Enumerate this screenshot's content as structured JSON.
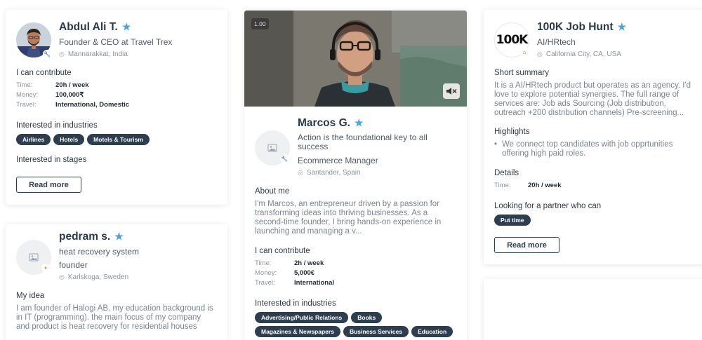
{
  "cards": {
    "abdul": {
      "name": "Abdul Ali T.",
      "role": "Founder & CEO at Travel Trex",
      "location": "Mannarakkat, India",
      "contribute_title": "I can contribute",
      "time_label": "Time:",
      "time_value": "20h / week",
      "money_label": "Money:",
      "money_value": "100,000₹",
      "travel_label": "Travel:",
      "travel_value": "International, Domestic",
      "industries_title": "Interested in industries",
      "industries": [
        "Airlines",
        "Hotels",
        "Motels & Tourism"
      ],
      "stages_title": "Interested in stages",
      "read_more": "Read more"
    },
    "pedram": {
      "name": "pedram s.",
      "tagline": "heat recovery system",
      "role": "founder",
      "location": "Karlskoga, Sweden",
      "idea_title": "My idea",
      "idea_text": "I am founder of Halogi AB. my education background is in IT (programming). the main focus of my company and product is heat recovery for residential houses"
    },
    "marcos": {
      "video_rate": "1.00",
      "name": "Marcos G.",
      "tagline": "Action is the foundational key to all success",
      "role": "Ecommerce Manager",
      "location": "Santander, Spain",
      "about_title": "About me",
      "about_text": "I'm Marcos, an entrepreneur driven by a passion for transforming ideas into thriving businesses. As a second-time founder, I bring hands-on experience in launching and managing a v...",
      "contribute_title": "I can contribute",
      "time_label": "Time:",
      "time_value": "2h / week",
      "money_label": "Money:",
      "money_value": "5,000€",
      "travel_label": "Travel:",
      "travel_value": "International",
      "industries_title": "Interested in industries",
      "industries": [
        "Advertising/Public Relations",
        "Books",
        "Magazines & Newspapers",
        "Business Services",
        "Education"
      ]
    },
    "job": {
      "logo_text": "100K",
      "name": "100K Job Hunt",
      "role": "AI/HRtech",
      "location": "California City, CA, USA",
      "summary_title": "Short summary",
      "summary_text": "It is a AI/HRtech product but operates as an agency. I'd love to explore potential synergies. The full range of services are: Job ads Sourcing (Job distribution, outreach +200 distribution channels) Pre-screening...",
      "highlights_title": "Highlights",
      "highlights": [
        "We connect top candidates with job opprtunities offering high paid roles."
      ],
      "details_title": "Details",
      "time_label": "Time:",
      "time_value": "20h / week",
      "partner_title": "Looking for a partner who can",
      "partner_tags": [
        "Put time"
      ],
      "read_more": "Read more"
    }
  },
  "icons": {
    "star": "star-icon",
    "pin": "location-pin-icon",
    "placeholder": "image-placeholder-icon",
    "verify": "wrench-badge-icon",
    "mute": "speaker-muted-icon"
  },
  "colors": {
    "accent_star": "#4da3dc",
    "tag_bg": "#2c3e50",
    "heading": "#2a3a4a"
  }
}
